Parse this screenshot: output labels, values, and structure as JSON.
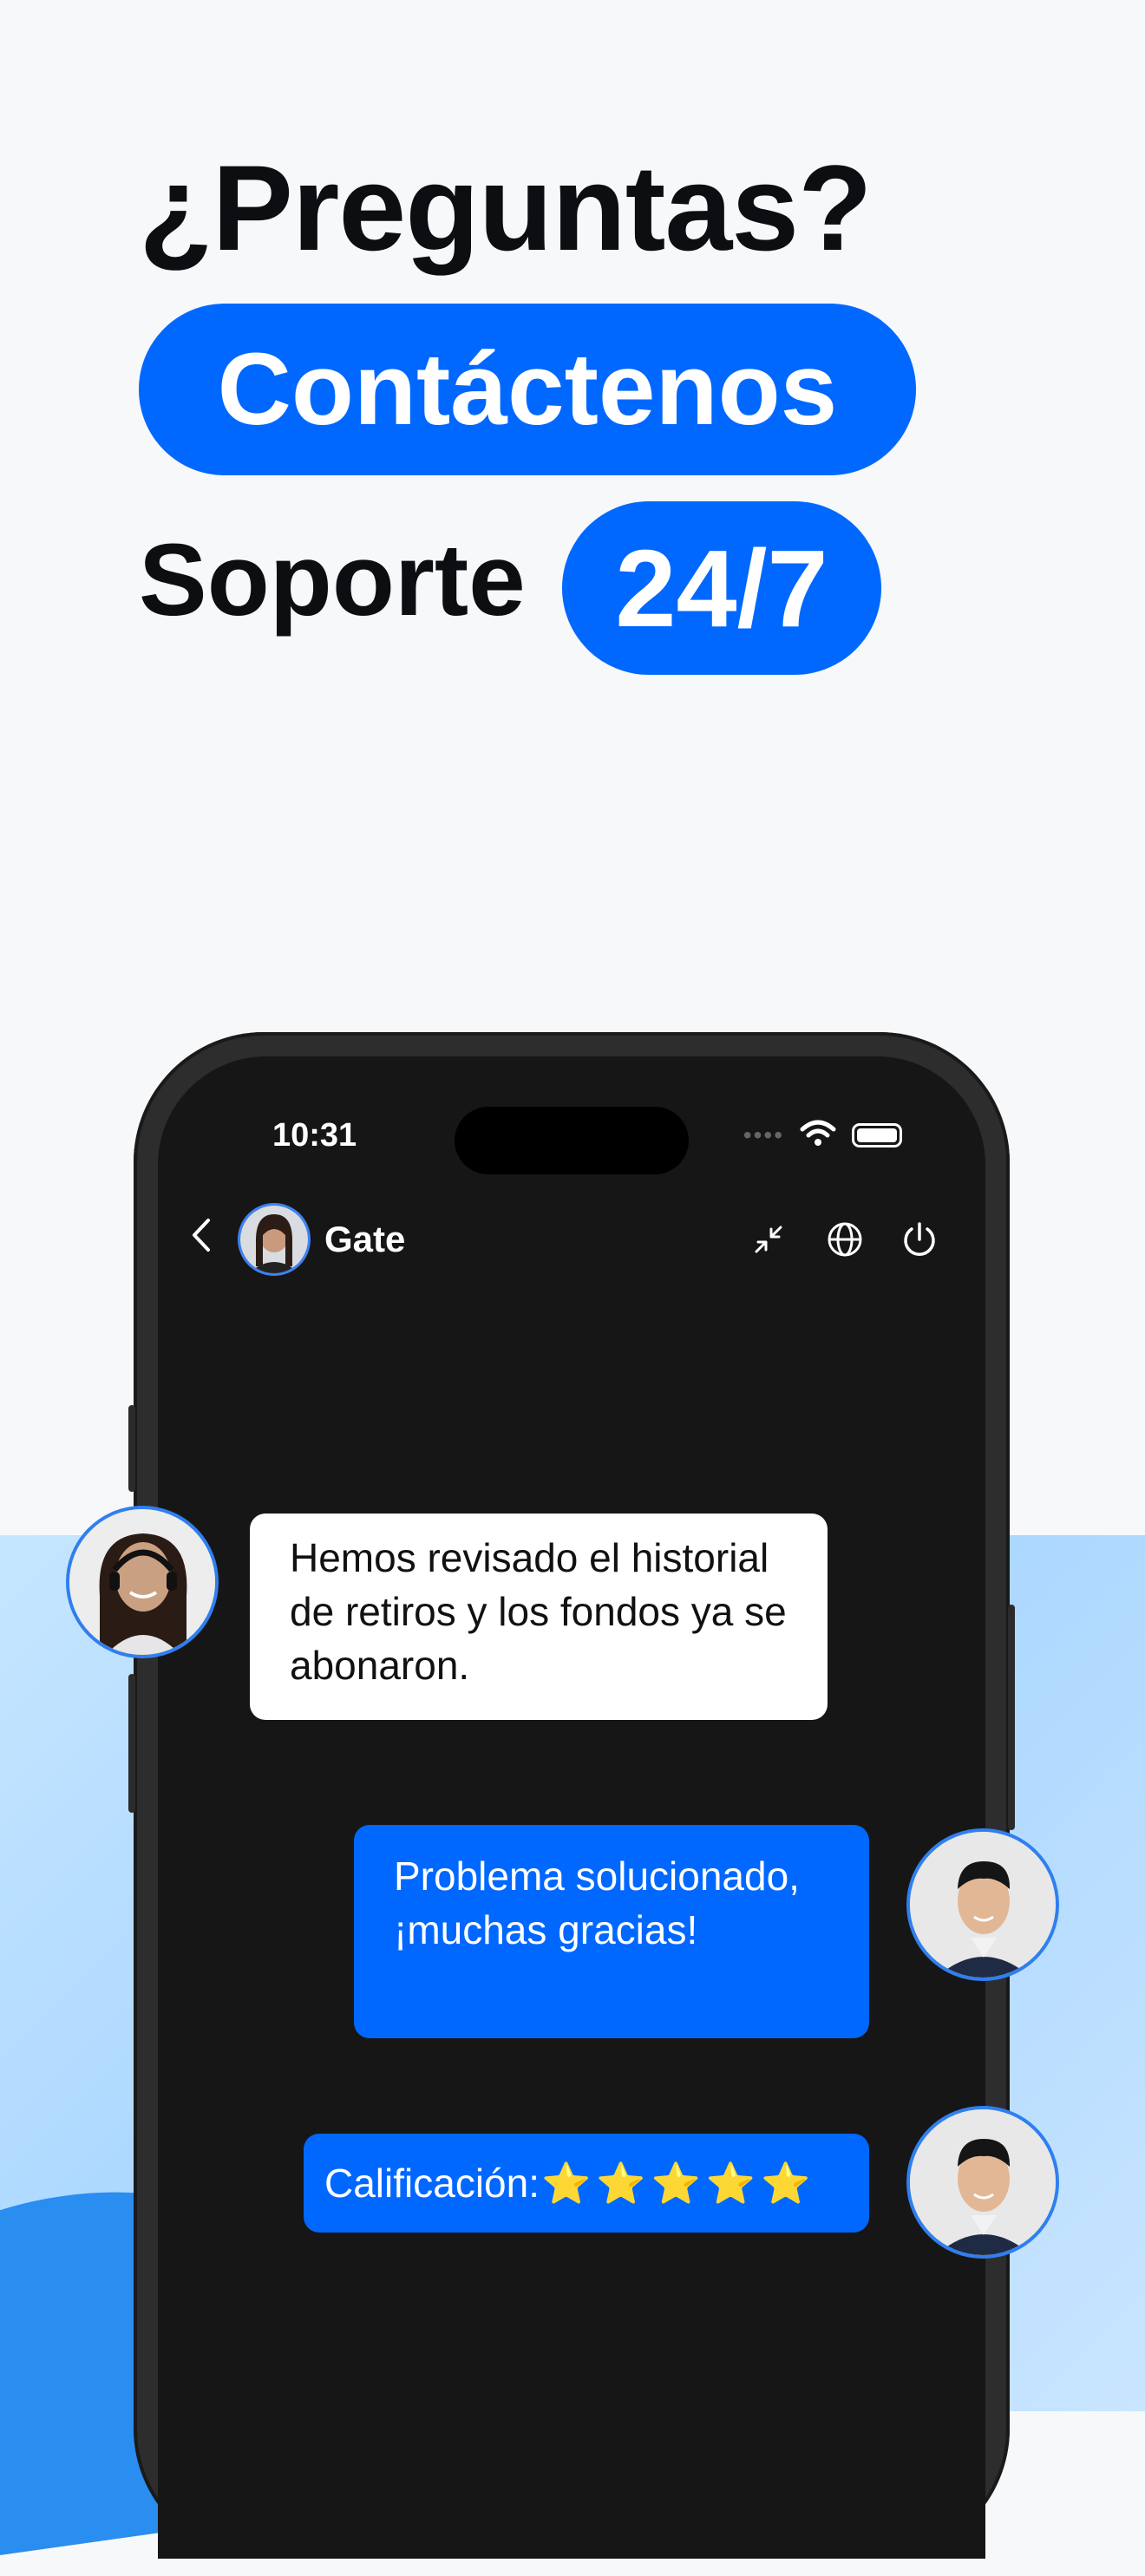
{
  "headline": {
    "question": "¿Preguntas?",
    "cta": "Contáctenos",
    "support_word": "Soporte",
    "support_hours": "24/7"
  },
  "phone": {
    "status_time": "10:31",
    "chat": {
      "title": "Gate",
      "icons": [
        "chevron-left-icon",
        "minimize-icon",
        "globe-icon",
        "power-icon"
      ]
    }
  },
  "messages": [
    {
      "from": "agent",
      "text": "Hemos revisado el historial de retiros y los fondos ya se abonaron."
    },
    {
      "from": "user",
      "text": "Problema solucionado, ¡muchas gracias!"
    },
    {
      "from": "user",
      "label": "Calificación:",
      "stars": "⭐⭐⭐⭐⭐",
      "rating": 5
    }
  ],
  "colors": {
    "accent": "#0068ff",
    "background": "#f7f8fa",
    "light_blue": "#b9ddff",
    "chat_bg": "#161616"
  }
}
